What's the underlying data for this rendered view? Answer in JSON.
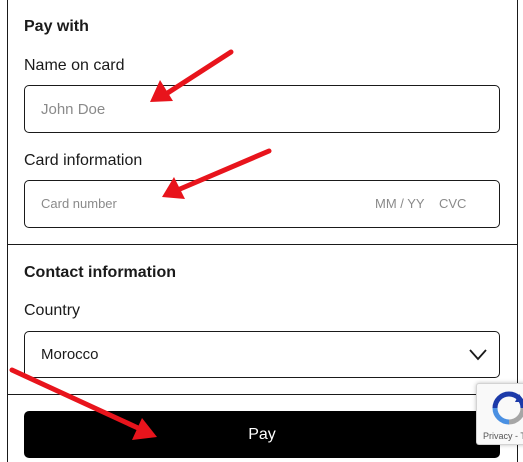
{
  "pay_with": {
    "heading": "Pay with",
    "name_on_card": {
      "label": "Name on card",
      "placeholder": "John Doe"
    },
    "card_information": {
      "label": "Card information",
      "card_number_placeholder": "Card number",
      "expiry_placeholder": "MM / YY",
      "cvc_placeholder": "CVC"
    }
  },
  "contact_information": {
    "heading": "Contact information",
    "country": {
      "label": "Country",
      "selected": "Morocco"
    }
  },
  "pay_button": {
    "label": "Pay"
  },
  "recaptcha": {
    "text": "Privacy - Te"
  },
  "colors": {
    "annotation_arrow": "#e8141c",
    "button_background": "#000000"
  }
}
